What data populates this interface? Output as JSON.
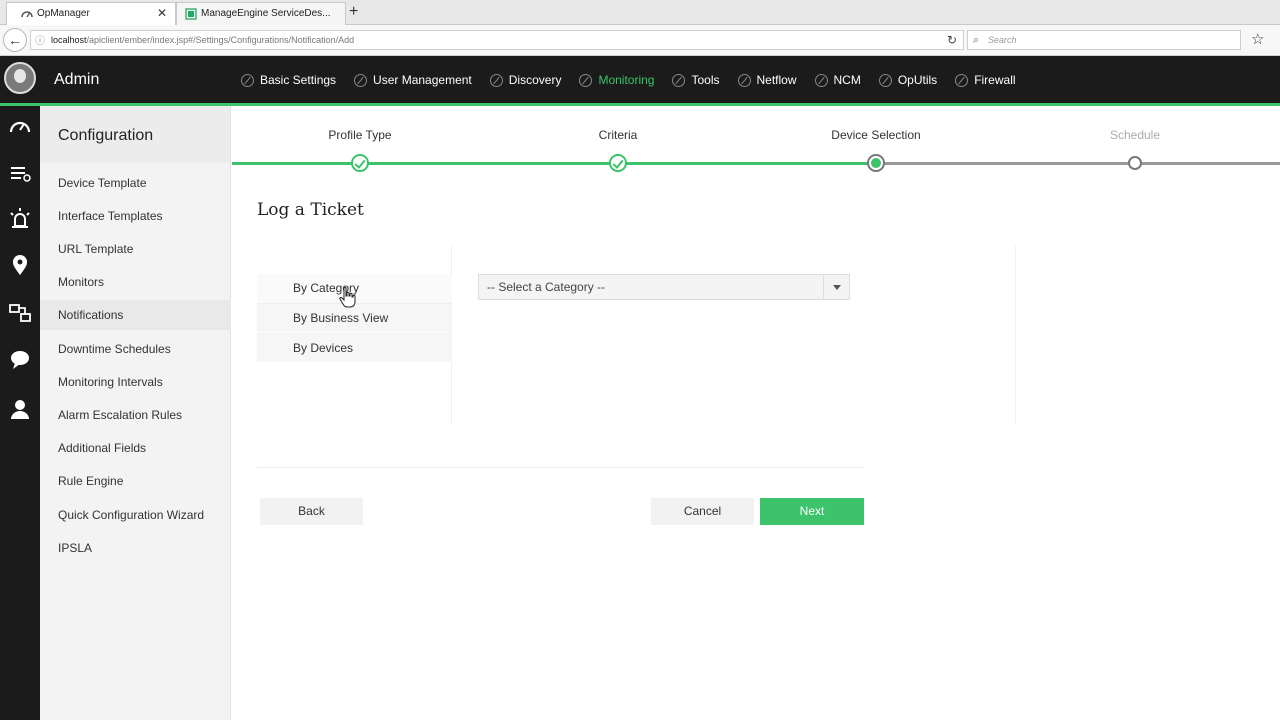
{
  "browser": {
    "tabs": [
      {
        "title": "OpManager",
        "active": true
      },
      {
        "title": "ManageEngine ServiceDes...",
        "active": false
      }
    ],
    "url_host": "localhost",
    "url_path": "/apiclient/ember/index.jsp#/Settings/Configurations/Notification/Add",
    "search_placeholder": "Search"
  },
  "header": {
    "title": "Admin",
    "nav": [
      {
        "label": "Basic Settings",
        "active": false
      },
      {
        "label": "User Management",
        "active": false
      },
      {
        "label": "Discovery",
        "active": false
      },
      {
        "label": "Monitoring",
        "active": true
      },
      {
        "label": "Tools",
        "active": false
      },
      {
        "label": "Netflow",
        "active": false
      },
      {
        "label": "NCM",
        "active": false
      },
      {
        "label": "OpUtils",
        "active": false
      },
      {
        "label": "Firewall",
        "active": false
      }
    ]
  },
  "sidebar": {
    "title": "Configuration",
    "items": [
      {
        "label": "Device Template"
      },
      {
        "label": "Interface Templates"
      },
      {
        "label": "URL Template"
      },
      {
        "label": "Monitors"
      },
      {
        "label": "Notifications",
        "active": true
      },
      {
        "label": "Downtime Schedules"
      },
      {
        "label": "Monitoring Intervals"
      },
      {
        "label": "Alarm Escalation Rules"
      },
      {
        "label": "Additional Fields"
      },
      {
        "label": "Rule Engine"
      },
      {
        "label": "Quick Configuration Wizard"
      },
      {
        "label": "IPSLA"
      }
    ]
  },
  "wizard": {
    "steps": [
      {
        "label": "Profile Type",
        "state": "done"
      },
      {
        "label": "Criteria",
        "state": "done"
      },
      {
        "label": "Device Selection",
        "state": "current"
      },
      {
        "label": "Schedule",
        "state": "pending"
      }
    ]
  },
  "main": {
    "title": "Log a Ticket",
    "options": [
      "By Category",
      "By Business View",
      "By Devices"
    ],
    "category_select": "-- Select a Category --",
    "buttons": {
      "back": "Back",
      "cancel": "Cancel",
      "next": "Next"
    }
  },
  "colors": {
    "accent": "#3cc36b",
    "header_bg": "#1b1b1b"
  }
}
